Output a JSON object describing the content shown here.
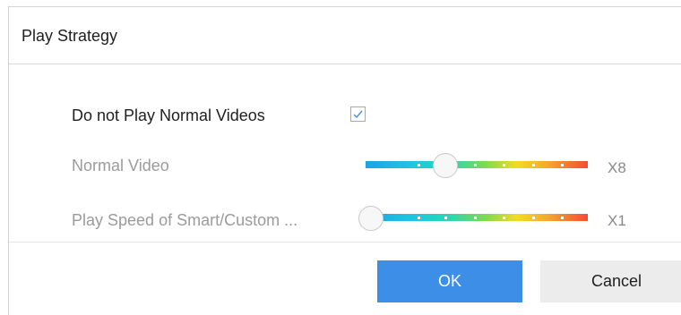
{
  "dialog": {
    "title": "Play Strategy"
  },
  "options": {
    "skip_normal": {
      "label": "Do not Play Normal Videos",
      "checked": true
    },
    "normal_video": {
      "label": "Normal Video",
      "speed": "X8",
      "level": 0.36,
      "disabled": true
    },
    "smart_speed": {
      "label": "Play Speed of Smart/Custom ...",
      "speed": "X1",
      "level": 0.0,
      "disabled": true
    }
  },
  "buttons": {
    "ok": "OK",
    "cancel": "Cancel"
  },
  "colors": {
    "primary_button": "#3d8ee6",
    "secondary_button": "#ececec",
    "disabled_text": "#9b9b9b"
  }
}
